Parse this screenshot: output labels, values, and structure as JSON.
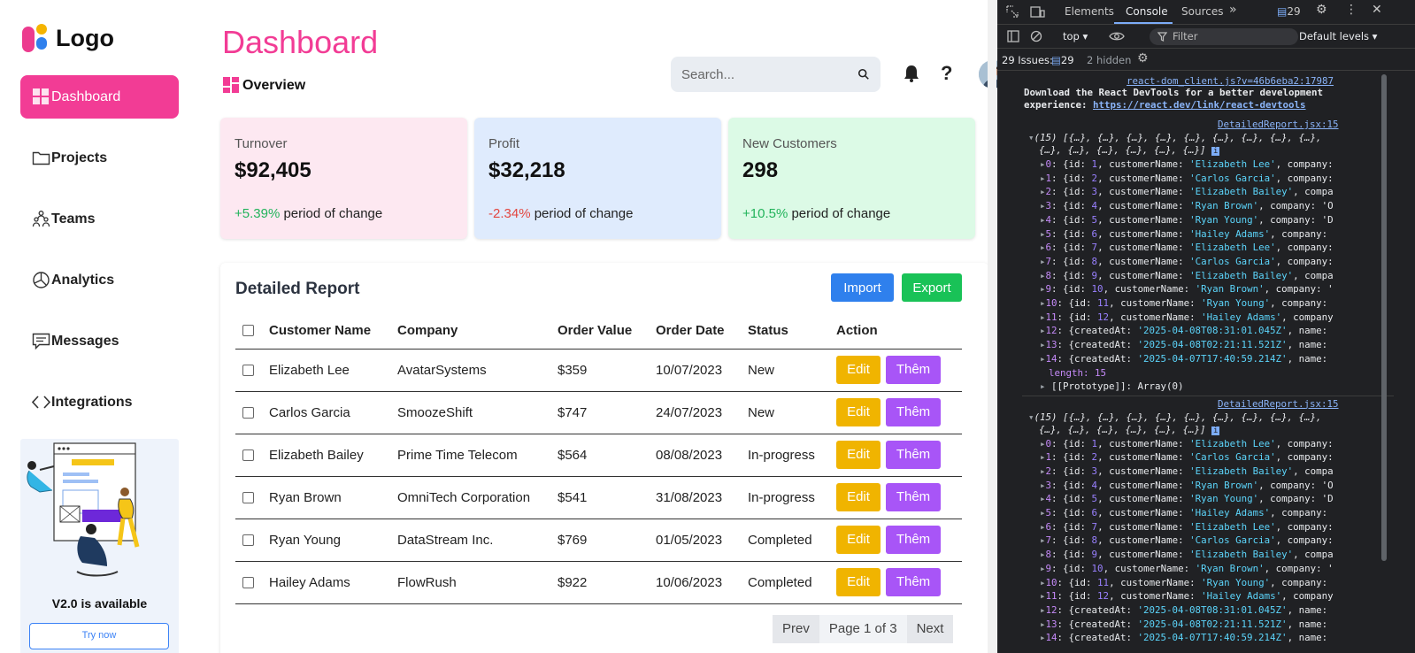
{
  "sidebar": {
    "logo_text": "Logo",
    "items": [
      {
        "label": "Dashboard",
        "icon": "squares-icon",
        "active": true
      },
      {
        "label": "Projects",
        "icon": "folder-icon"
      },
      {
        "label": "Teams",
        "icon": "team-icon"
      },
      {
        "label": "Analytics",
        "icon": "pie-chart-icon"
      },
      {
        "label": "Messages",
        "icon": "chat-icon"
      },
      {
        "label": "Integrations",
        "icon": "code-icon"
      }
    ],
    "promo": {
      "title": "V2.0 is available",
      "button": "Try now"
    }
  },
  "header": {
    "title": "Dashboard",
    "subtitle": "Overview",
    "search_placeholder": "Search...",
    "help": "?"
  },
  "cards": [
    {
      "label": "Turnover",
      "value": "$92,405",
      "change": "+5.39%",
      "suffix": "period of change",
      "trend": "pos",
      "bg": "#fde8f1"
    },
    {
      "label": "Profit",
      "value": "$32,218",
      "change": "-2.34%",
      "suffix": "period of change",
      "trend": "neg",
      "bg": "#dfebfd"
    },
    {
      "label": "New Customers",
      "value": "298",
      "change": "+10.5%",
      "suffix": "period of change",
      "trend": "pos",
      "bg": "#dcfae6"
    }
  ],
  "report": {
    "title": "Detailed Report",
    "import_label": "Import",
    "export_label": "Export",
    "columns": [
      "Customer Name",
      "Company",
      "Order Value",
      "Order Date",
      "Status",
      "Action"
    ],
    "rows": [
      {
        "name": "Elizabeth Lee",
        "company": "AvatarSystems",
        "value": "$359",
        "date": "10/07/2023",
        "status": "New"
      },
      {
        "name": "Carlos Garcia",
        "company": "SmoozeShift",
        "value": "$747",
        "date": "24/07/2023",
        "status": "New"
      },
      {
        "name": "Elizabeth Bailey",
        "company": "Prime Time Telecom",
        "value": "$564",
        "date": "08/08/2023",
        "status": "In-progress"
      },
      {
        "name": "Ryan Brown",
        "company": "OmniTech Corporation",
        "value": "$541",
        "date": "31/08/2023",
        "status": "In-progress"
      },
      {
        "name": "Ryan Young",
        "company": "DataStream Inc.",
        "value": "$769",
        "date": "01/05/2023",
        "status": "Completed"
      },
      {
        "name": "Hailey Adams",
        "company": "FlowRush",
        "value": "$922",
        "date": "10/06/2023",
        "status": "Completed"
      }
    ],
    "edit_label": "Edit",
    "them_label": "Thêm",
    "pager": {
      "prev": "Prev",
      "info": "Page 1 of 3",
      "next": "Next"
    }
  },
  "devtools": {
    "tabs": [
      "Elements",
      "Console",
      "Sources"
    ],
    "issues_count": "29",
    "context": "top",
    "filter_placeholder": "Filter",
    "levels": "Default levels",
    "issues_label": "29 Issues:",
    "issues_num": "29",
    "hidden": "2 hidden",
    "log_link": "react-dom_client.js?v=46b6eba2:17987",
    "log_msg1": "Download the React DevTools for a better development",
    "log_msg2_prefix": "experience: ",
    "log_msg2_link": "https://react.dev/link/react-devtools",
    "source_link": "DetailedReport.jsx:15",
    "array_head1": "(15) [{…}, {…}, {…}, {…}, {…}, {…}, {…}, {…}, {…},",
    "array_head2": "{…}, {…}, {…}, {…}, {…}, {…}]",
    "entries": [
      {
        "i": "0",
        "id": "1",
        "name": "'Elizabeth Lee'",
        "tail": ", company:"
      },
      {
        "i": "1",
        "id": "2",
        "name": "'Carlos Garcia'",
        "tail": ", company:"
      },
      {
        "i": "2",
        "id": "3",
        "name": "'Elizabeth Bailey'",
        "tail": ", compa"
      },
      {
        "i": "3",
        "id": "4",
        "name": "'Ryan Brown'",
        "tail": ", company: 'O"
      },
      {
        "i": "4",
        "id": "5",
        "name": "'Ryan Young'",
        "tail": ", company: 'D"
      },
      {
        "i": "5",
        "id": "6",
        "name": "'Hailey Adams'",
        "tail": ", company:"
      },
      {
        "i": "6",
        "id": "7",
        "name": "'Elizabeth Lee'",
        "tail": ", company:"
      },
      {
        "i": "7",
        "id": "8",
        "name": "'Carlos Garcia'",
        "tail": ", company:"
      },
      {
        "i": "8",
        "id": "9",
        "name": "'Elizabeth Bailey'",
        "tail": ", compa"
      },
      {
        "i": "9",
        "id": "10",
        "name": "'Ryan Brown'",
        "tail": ", company: '"
      },
      {
        "i": "10",
        "id": "11",
        "name": "'Ryan Young'",
        "tail": ", company:"
      },
      {
        "i": "11",
        "id": "12",
        "name": "'Hailey Adams'",
        "tail": ", company"
      }
    ],
    "created": [
      {
        "i": "12",
        "at": "'2025-04-08T08:31:01.045Z'"
      },
      {
        "i": "13",
        "at": "'2025-04-08T02:21:11.521Z'"
      },
      {
        "i": "14",
        "at": "'2025-04-07T17:40:59.214Z'"
      }
    ],
    "length_line": "length: 15",
    "proto_line": "[[Prototype]]: Array(0)"
  }
}
